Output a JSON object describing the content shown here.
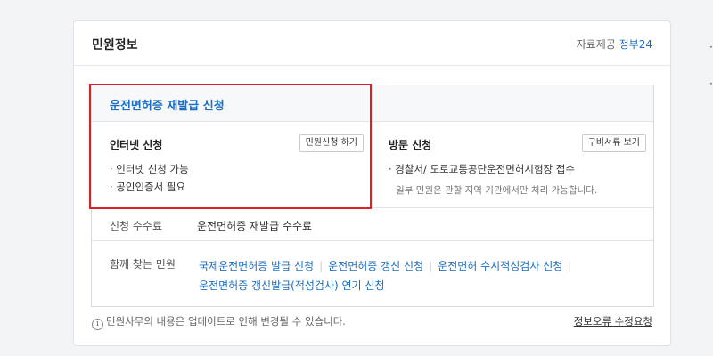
{
  "card": {
    "title": "민원정보",
    "provider_label": "자료제공",
    "provider_link": "정부24"
  },
  "service": {
    "title": "운전면허증 재발급 신청",
    "internet": {
      "heading": "인터넷 신청",
      "button": "민원신청 하기",
      "bullets": [
        "· 인터넷 신청 가능",
        "· 공인인증서 필요"
      ]
    },
    "visit": {
      "heading": "방문 신청",
      "button": "구비서류 보기",
      "bullets": [
        "· 경찰서/ 도로교통공단운전면허시험장 접수"
      ],
      "note": "일부 민원은 관할 지역 기관에서만 처리 가능합니다."
    },
    "fee": {
      "label": "신청 수수료",
      "value": "운전면허증 재발급 수수료"
    },
    "related": {
      "label": "함께 찾는 민원",
      "links": [
        "국제운전면허증 발급 신청",
        "운전면허증 갱신 신청",
        "운전면허 수시적성검사 신청",
        "운전면허증 갱신발급(적성검사) 연기 신청"
      ]
    }
  },
  "footer": {
    "info_icon": "i",
    "note": "민원사무의 내용은 업데이트로 인해 변경될 수 있습니다.",
    "report_link": "정보오류 수정요청"
  },
  "colors": {
    "link": "#1b6ec2",
    "highlight": "#e02020"
  }
}
